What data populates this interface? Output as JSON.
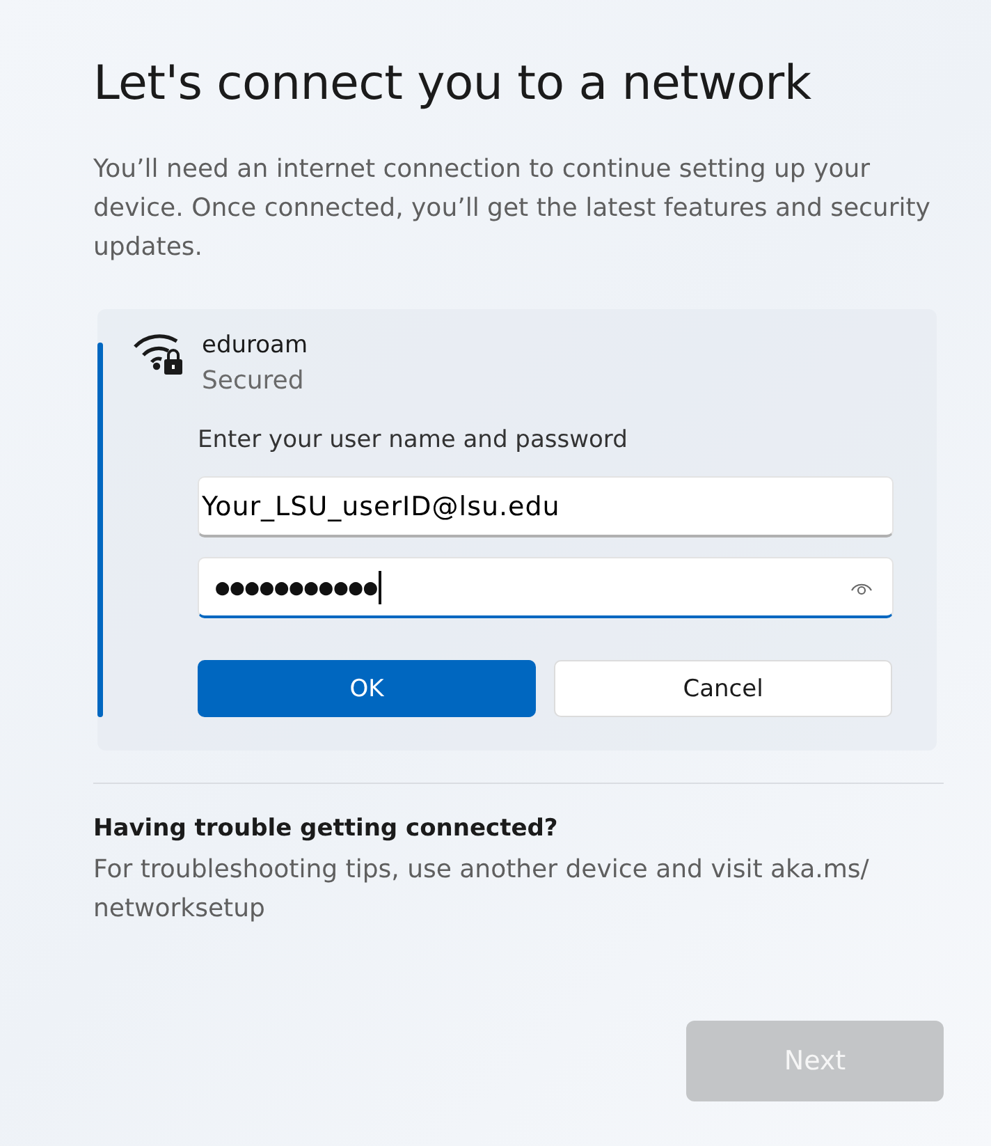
{
  "title": "Let's connect you to a network",
  "intro": "You’ll need an internet connection to continue setting up your device. Once connected, you’ll get the latest features and security updates.",
  "network": {
    "name": "eduroam",
    "status": "Secured",
    "selected": true,
    "prompt": "Enter your user name and password",
    "username": {
      "value": "Your_LSU_userID@lsu.edu",
      "focused": false
    },
    "password": {
      "value": "●●●●●●●●●●●",
      "focused": true
    },
    "buttons": [
      {
        "label": "OK",
        "kind": "primary"
      },
      {
        "label": "Cancel",
        "kind": "secondary"
      }
    ]
  },
  "help": {
    "heading": "Having trouble getting connected?",
    "text": "For troubleshooting tips, use another device and visit aka.ms/ networksetup"
  },
  "next": {
    "label": "Next",
    "disabled": true
  }
}
